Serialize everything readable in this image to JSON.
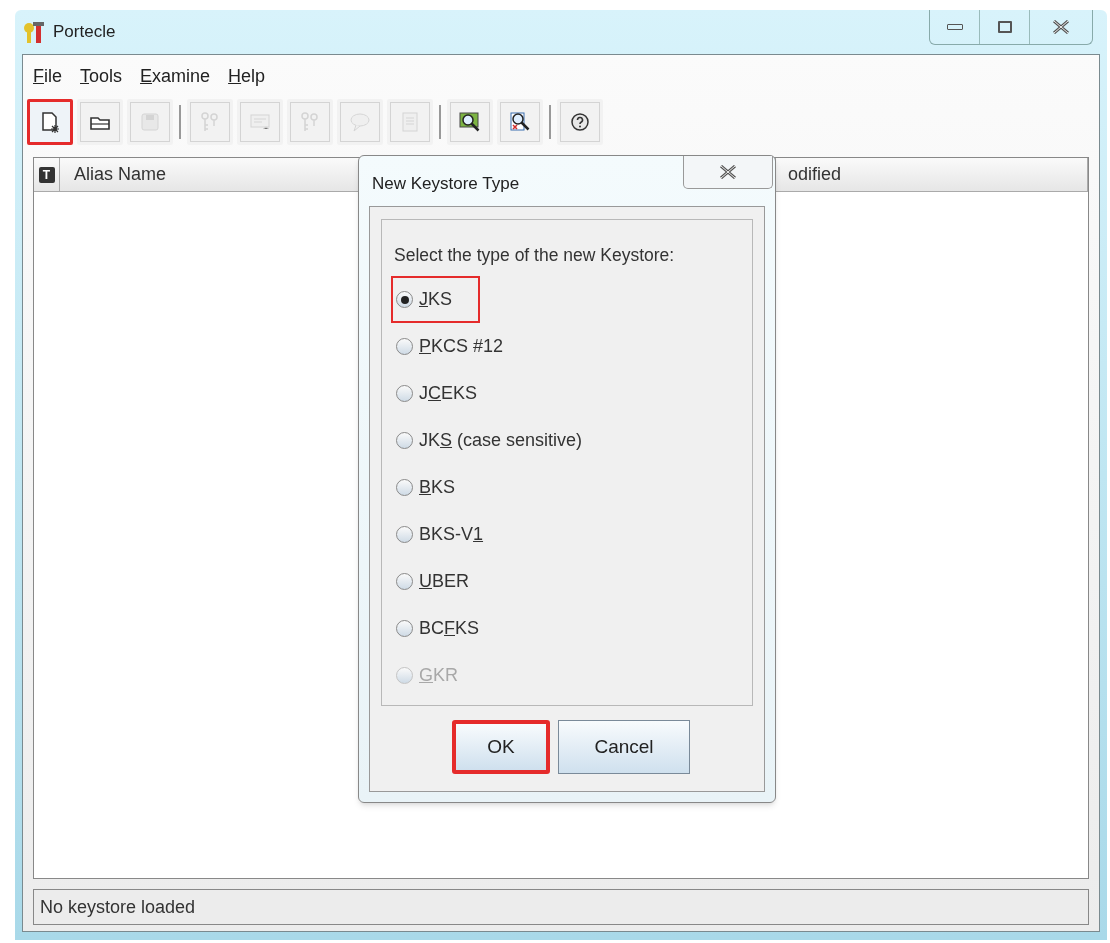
{
  "window": {
    "title": "Portecle"
  },
  "menu": [
    {
      "parts": {
        "key": "F",
        "after": "ile"
      }
    },
    {
      "parts": {
        "key": "T",
        "after": "ools"
      }
    },
    {
      "parts": {
        "key": "E",
        "after": "xamine"
      }
    },
    {
      "parts": {
        "key": "H",
        "after": "elp"
      }
    }
  ],
  "toolbar": [
    {
      "kind": "new",
      "disabled": false,
      "highlighted": true
    },
    {
      "kind": "open",
      "disabled": false,
      "highlighted": false
    },
    {
      "kind": "save",
      "disabled": true,
      "highlighted": false
    },
    {
      "kind": "separator"
    },
    {
      "kind": "keypair",
      "disabled": true,
      "highlighted": false
    },
    {
      "kind": "certificate",
      "disabled": true,
      "highlighted": false
    },
    {
      "kind": "import-keypair",
      "disabled": true,
      "highlighted": false
    },
    {
      "kind": "report",
      "disabled": true,
      "highlighted": false
    },
    {
      "kind": "properties",
      "disabled": true,
      "highlighted": false
    },
    {
      "kind": "separator"
    },
    {
      "kind": "examine-cert",
      "disabled": false,
      "highlighted": false
    },
    {
      "kind": "examine-crl",
      "disabled": false,
      "highlighted": false
    },
    {
      "kind": "separator"
    },
    {
      "kind": "help",
      "disabled": false,
      "highlighted": false
    }
  ],
  "table": {
    "columns": [
      {
        "kind": "icon",
        "label": "T"
      },
      {
        "kind": "text",
        "label": "Alias Name"
      },
      {
        "kind": "text",
        "label": "odified"
      }
    ]
  },
  "status_bar": "No keystore loaded",
  "dialog": {
    "title": "New Keystore Type",
    "prompt": "Select the type of the new Keystore:",
    "options": [
      {
        "parts": {
          "key": "J",
          "after": "KS"
        },
        "selected": true,
        "disabled": false,
        "highlighted": true
      },
      {
        "parts": {
          "key": "P",
          "after": "KCS #12"
        },
        "selected": false,
        "disabled": false,
        "highlighted": false
      },
      {
        "parts": {
          "before": "J",
          "key": "C",
          "after": "EKS"
        },
        "selected": false,
        "disabled": false,
        "highlighted": false
      },
      {
        "parts": {
          "before": "JK",
          "key": "S",
          "after": " (case sensitive)"
        },
        "selected": false,
        "disabled": false,
        "highlighted": false
      },
      {
        "parts": {
          "key": "B",
          "after": "KS"
        },
        "selected": false,
        "disabled": false,
        "highlighted": false
      },
      {
        "parts": {
          "before": "BKS-V",
          "key": "1"
        },
        "selected": false,
        "disabled": false,
        "highlighted": false
      },
      {
        "parts": {
          "key": "U",
          "after": "BER"
        },
        "selected": false,
        "disabled": false,
        "highlighted": false
      },
      {
        "parts": {
          "before": "BC",
          "key": "F",
          "after": "KS"
        },
        "selected": false,
        "disabled": false,
        "highlighted": false
      },
      {
        "parts": {
          "key": "G",
          "after": "KR"
        },
        "selected": false,
        "disabled": true,
        "highlighted": false
      }
    ],
    "buttons": [
      {
        "label": "OK",
        "highlighted": true
      },
      {
        "label": "Cancel",
        "highlighted": false
      }
    ]
  }
}
